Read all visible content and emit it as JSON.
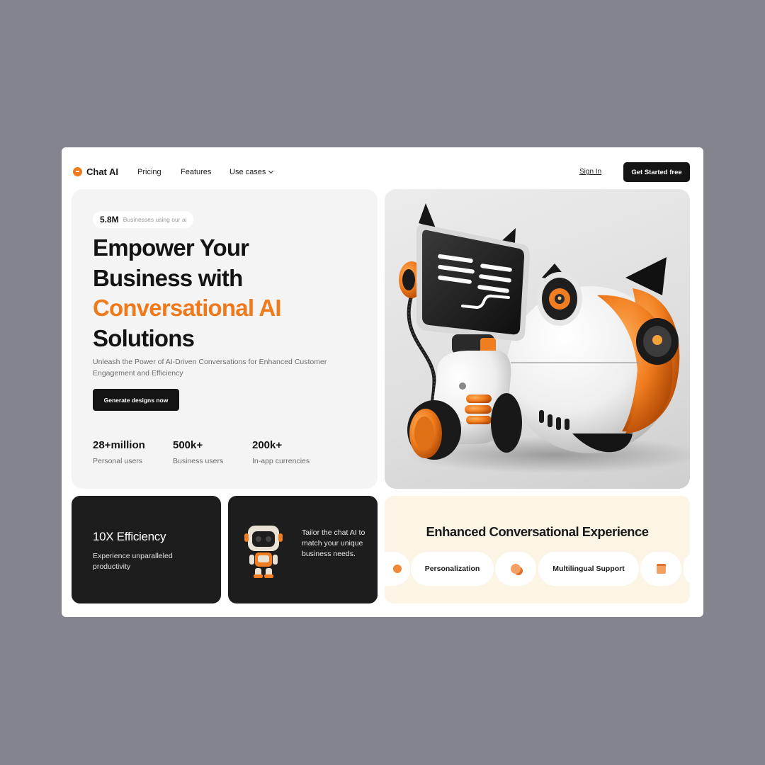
{
  "nav": {
    "brand": "Chat AI",
    "links": [
      "Pricing",
      "Features",
      "Use cases"
    ],
    "sign_in": "Sign In",
    "cta": "Get Started free"
  },
  "hero": {
    "badge_value": "5.8M",
    "badge_label": "Businesses using our ai",
    "headline_line1": "Empower Your",
    "headline_line2": "Business with",
    "headline_accent": "Conversational AI",
    "headline_line4": "Solutions",
    "subtext": "Unleash the Power of AI-Driven Conversations for Enhanced Customer Engagement and Efficiency",
    "button": "Generate designs now",
    "stats": [
      {
        "value": "28+million",
        "label": "Personal users"
      },
      {
        "value": "500k+",
        "label": "Business users"
      },
      {
        "value": "200k+",
        "label": "In-app currencies"
      }
    ]
  },
  "efficiency": {
    "title": "10X Efficiency",
    "desc": "Experience unparalleled productivity"
  },
  "tailor": {
    "text": "Tailor the chat AI to match your unique business needs."
  },
  "experience": {
    "title": "Enhanced Conversational Experience",
    "features": [
      "Personalization",
      "Multilingual Support"
    ]
  },
  "colors": {
    "accent": "#ef7a1c",
    "dark": "#1d1d1d",
    "cream": "#fcf5e6",
    "backdrop": "#84848e"
  }
}
